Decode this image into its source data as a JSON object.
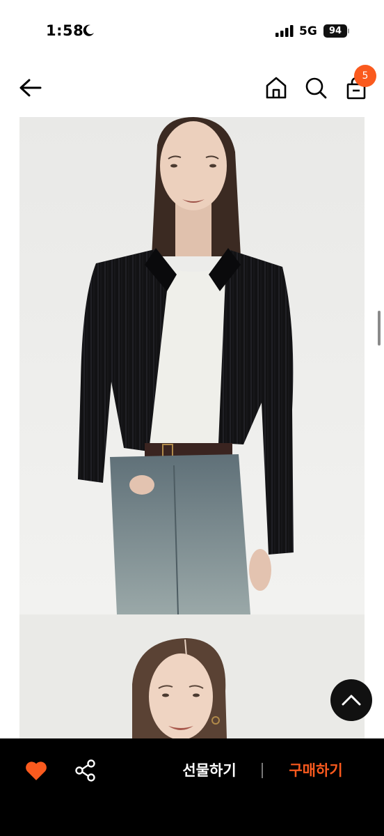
{
  "status_bar": {
    "time": "1:58",
    "network": "5G",
    "battery": "94"
  },
  "header": {
    "icons": [
      "back-arrow-icon",
      "home-icon",
      "search-icon",
      "cart-icon"
    ],
    "cart_count": "5"
  },
  "product": {
    "images": [
      "model-black-lace-cardigan-full",
      "model-portrait-closeup"
    ]
  },
  "bottom_bar": {
    "gift_label": "선물하기",
    "buy_label": "구매하기",
    "icons": [
      "heart-icon",
      "share-icon"
    ]
  },
  "colors": {
    "accent": "#fa5a1e",
    "bottom_bar_bg": "#000000",
    "image_bg": "#ececec"
  }
}
